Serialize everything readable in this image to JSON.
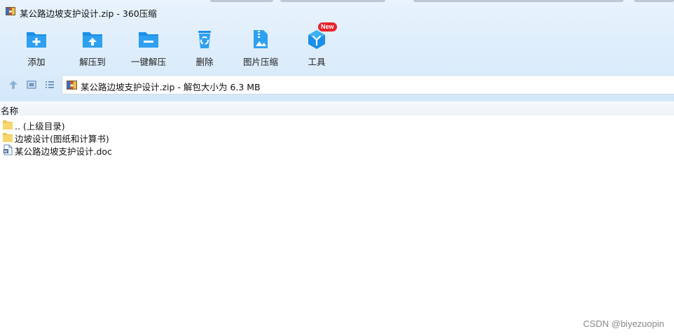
{
  "window": {
    "title": "某公路边坡支护设计.zip - 360压缩",
    "app_icon": "winrar-archive-icon"
  },
  "toolbar": {
    "buttons": [
      {
        "label": "添加",
        "icon": "folder-add-icon"
      },
      {
        "label": "解压到",
        "icon": "folder-extract-icon"
      },
      {
        "label": "一键解压",
        "icon": "folder-oneclick-icon"
      },
      {
        "label": "删除",
        "icon": "recycle-bin-icon"
      },
      {
        "label": "图片压缩",
        "icon": "image-compress-icon"
      },
      {
        "label": "工具",
        "icon": "tools-cube-icon",
        "badge": "New"
      }
    ]
  },
  "navbar": {
    "address": "某公路边坡支护设计.zip - 解包大小为 6.3 MB"
  },
  "file_list": {
    "column_name": "名称",
    "rows": [
      {
        "name": ".. (上级目录)",
        "icon": "folder-icon"
      },
      {
        "name": "边坡设计(图纸和计算书)",
        "icon": "folder-icon"
      },
      {
        "name": "某公路边坡支护设计.doc",
        "icon": "word-document-icon"
      }
    ]
  },
  "watermark": "CSDN @biyezuopin",
  "colors": {
    "toolbar_bg": "#dcecfb",
    "icon_blue": "#1a8ee8",
    "badge_red": "#e8222b",
    "folder_yellow": "#f7d66b"
  }
}
